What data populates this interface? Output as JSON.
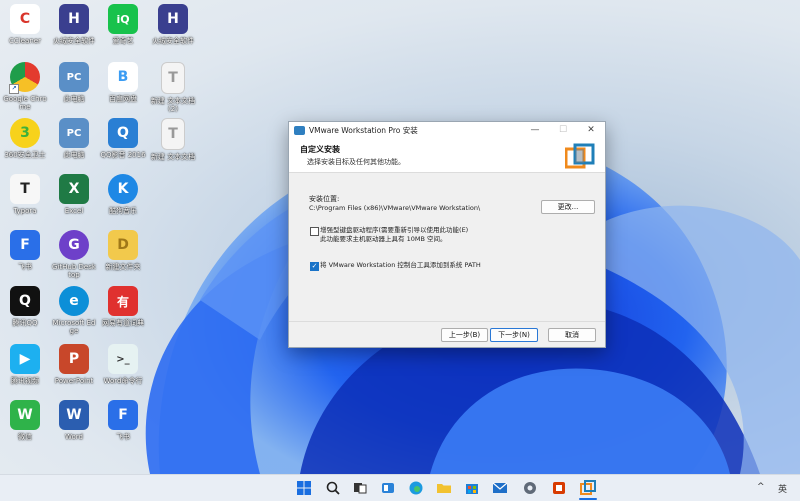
{
  "desktop": {
    "icons": [
      {
        "label": "CCleaner",
        "glyph": "C",
        "color": "#d9352b"
      },
      {
        "label": "火绒安全软件",
        "glyph": "H",
        "color": "#3a3f8f"
      },
      {
        "label": "爱奇艺",
        "glyph": "iQ",
        "color": "#18c24c"
      },
      {
        "label": "火绒安全软件",
        "glyph": "H",
        "color": "#3a3f8f"
      },
      {
        "label": "Google Chrome",
        "glyph": "G",
        "color": "#1a73e8"
      },
      {
        "label": "此电脑",
        "glyph": "PC",
        "color": "#5a8fc7"
      },
      {
        "label": "百度网盘",
        "glyph": "B",
        "color": "#3b9cf3"
      },
      {
        "label": "新建 文本文档 (2)",
        "glyph": "T",
        "color": "#cfcfcf"
      },
      {
        "label": "360安全卫士",
        "glyph": "3",
        "color": "#3db13a"
      },
      {
        "label": "此电脑",
        "glyph": "PC",
        "color": "#5a8fc7"
      },
      {
        "label": "QQ影音 2016",
        "glyph": "Q",
        "color": "#2a7fd4"
      },
      {
        "label": "新建 文本文档",
        "glyph": "T",
        "color": "#cfcfcf"
      },
      {
        "label": "Typora",
        "glyph": "T",
        "color": "#f7f7f7"
      },
      {
        "label": "Excel",
        "glyph": "X",
        "color": "#1f7a45"
      },
      {
        "label": "酷狗音乐",
        "glyph": "K",
        "color": "#1e88e5"
      },
      {
        "label": "飞书",
        "glyph": "F",
        "color": "#2a6fe8"
      },
      {
        "label": "GitHub Desktop",
        "glyph": "G",
        "color": "#6e40c9"
      },
      {
        "label": "新建文件夹",
        "glyph": "D",
        "color": "#f2c94c"
      },
      {
        "label": "腾讯QQ",
        "glyph": "Q",
        "color": "#111111"
      },
      {
        "label": "Microsoft Edge",
        "glyph": "e",
        "color": "#0c8fd8"
      },
      {
        "label": "网易有道词典",
        "glyph": "有",
        "color": "#e0312f"
      },
      {
        "label": "腾讯视频",
        "glyph": "▶",
        "color": "#1db0f0"
      },
      {
        "label": "PowerPoint",
        "glyph": "P",
        "color": "#c8472a"
      },
      {
        "label": "Word命令行",
        "glyph": ">_",
        "color": "#e6f2f2"
      },
      {
        "label": "微信",
        "glyph": "W",
        "color": "#2fb34a"
      },
      {
        "label": "Word",
        "glyph": "W",
        "color": "#2b5eb0"
      },
      {
        "label": "飞书",
        "glyph": "F",
        "color": "#2a6fe8"
      }
    ]
  },
  "installer": {
    "title": "VMware Workstation Pro 安装",
    "header_title": "自定义安装",
    "header_subtitle": "选择安装目标及任何其他功能。",
    "install_location_label": "安装位置:",
    "install_path": "C:\\Program Files (x86)\\VMware\\VMware Workstation\\",
    "change_button": "更改...",
    "option1_text_line1": "增强型键盘驱动程序(需要重新引导以使用此功能(E)",
    "option1_text_line2": "此功能要求主机驱动器上具有 10MB 空间。",
    "option1_checked": false,
    "option2_text": "将 VMware Workstation 控制台工具添加到系统 PATH",
    "option2_checked": true,
    "back_button": "上一步(B)",
    "next_button": "下一步(N)",
    "cancel_button": "取消"
  },
  "taskbar": {
    "items": [
      "start-icon",
      "search-icon",
      "task-view-icon",
      "widgets-icon",
      "edge-icon",
      "file-explorer-icon",
      "store-icon",
      "mail-icon",
      "settings-icon",
      "office-icon",
      "vmware-icon"
    ],
    "tray_chevron": "^",
    "ime": "英"
  }
}
